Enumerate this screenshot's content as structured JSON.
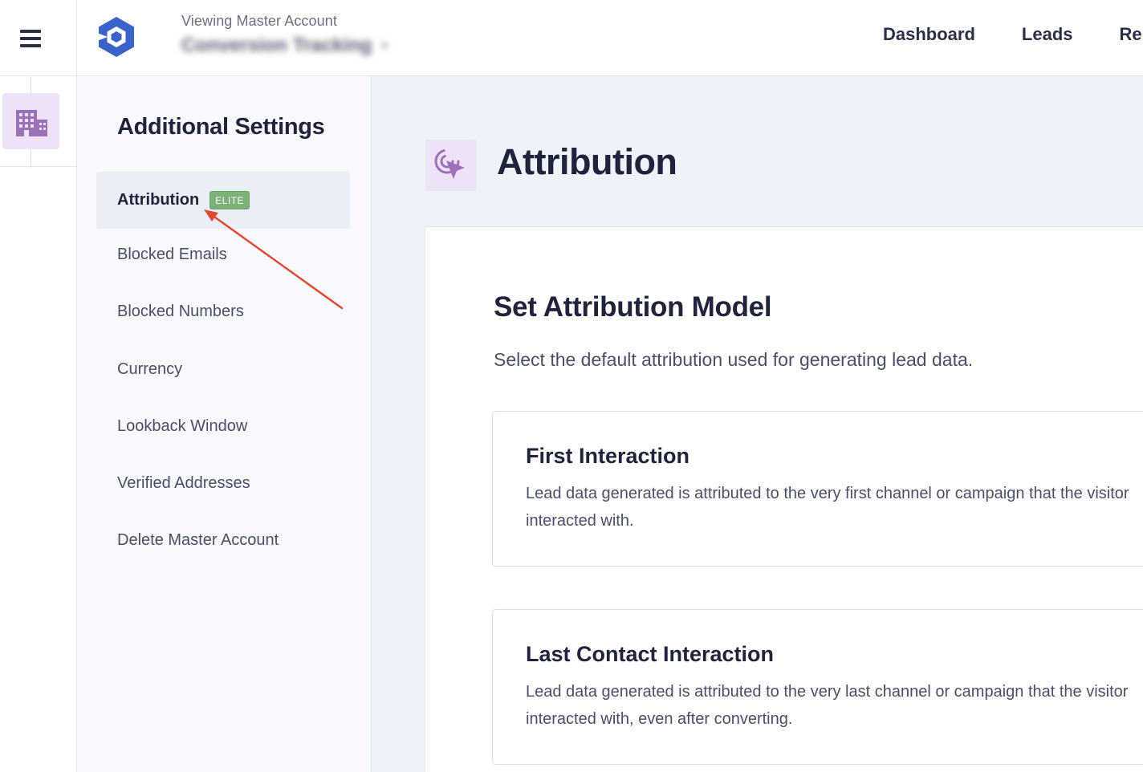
{
  "header": {
    "account_label": "Viewing Master Account",
    "account_name": "Conversion Tracking",
    "nav": [
      "Dashboard",
      "Leads",
      "Re"
    ]
  },
  "settings": {
    "title": "Additional Settings",
    "items": [
      {
        "label": "Attribution",
        "badge": "ELITE",
        "active": true
      },
      {
        "label": "Blocked Emails"
      },
      {
        "label": "Blocked Numbers"
      },
      {
        "label": "Currency"
      },
      {
        "label": "Lookback Window"
      },
      {
        "label": "Verified Addresses"
      },
      {
        "label": "Delete Master Account"
      }
    ]
  },
  "main": {
    "title": "Attribution",
    "section_title": "Set Attribution Model",
    "section_desc": "Select the default attribution used for generating lead data.",
    "options": [
      {
        "title": "First Interaction",
        "desc": "Lead data generated is attributed to the very first channel or campaign that the visitor interacted with."
      },
      {
        "title": "Last Contact Interaction",
        "desc": "Lead data generated is attributed to the very last channel or campaign that the visitor interacted with, even after converting."
      }
    ]
  },
  "colors": {
    "brand_blue": "#3a63c9",
    "accent_purple": "#9b72b8",
    "elite_green": "#7cb27a",
    "annotation_red": "#e04a35"
  },
  "icons": {
    "menu": "hamburger-icon",
    "logo": "hexagon-logo-icon",
    "rail": "building-icon",
    "page": "cursor-click-icon"
  }
}
